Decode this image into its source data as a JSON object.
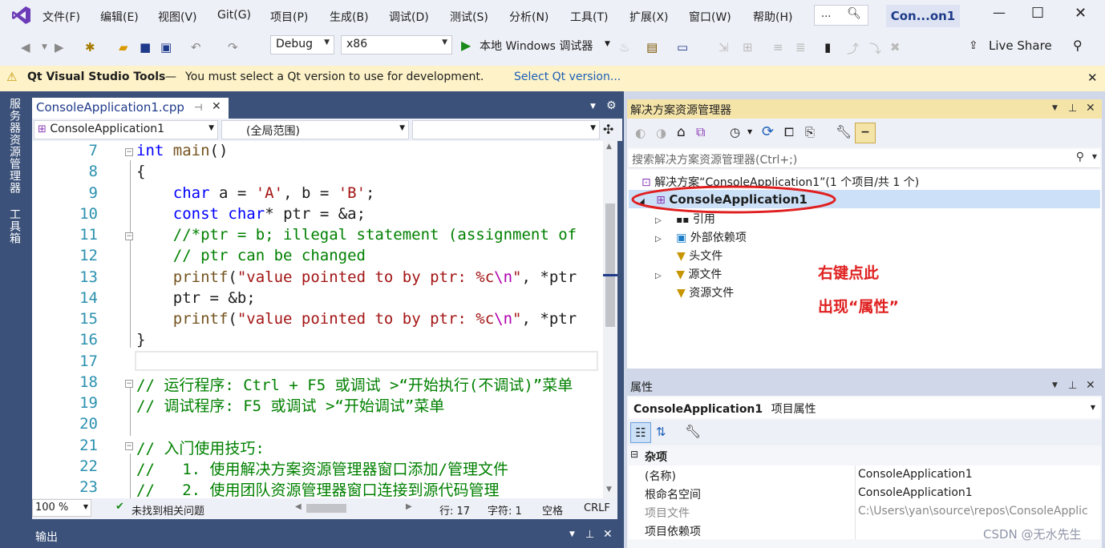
{
  "menu": {
    "items": [
      "文件(F)",
      "编辑(E)",
      "视图(V)",
      "Git(G)",
      "项目(P)",
      "生成(B)",
      "调试(D)",
      "测试(S)",
      "分析(N)",
      "工具(T)",
      "扩展(X)",
      "窗口(W)",
      "帮助(H)"
    ],
    "search_placeholder": "...",
    "title": "Con...on1"
  },
  "toolbar": {
    "config": "Debug",
    "platform": "x86",
    "run_label": "本地 Windows 调试器",
    "live_share": "Live Share"
  },
  "infobar": {
    "title": "Qt Visual Studio Tools",
    "dash": "—",
    "message": "You must select a Qt version to use for development.",
    "link": "Select Qt version..."
  },
  "side_tabs": [
    "服务器资源管理器",
    "工具箱"
  ],
  "editor": {
    "tab": "ConsoleApplication1.cpp",
    "nav_project": "ConsoleApplication1",
    "nav_scope": "(全局范围)",
    "nav_member": "",
    "line_numbers": [
      "7",
      "8",
      "9",
      "10",
      "11",
      "12",
      "13",
      "14",
      "15",
      "16",
      "17",
      "18",
      "19",
      "20",
      "21",
      "22",
      "23"
    ]
  },
  "status": {
    "zoom": "100 %",
    "issues": "未找到相关问题",
    "line": "行: 17",
    "char": "字符: 1",
    "spaces": "空格",
    "eol": "CRLF"
  },
  "output": {
    "title": "输出"
  },
  "solution_explorer": {
    "title": "解决方案资源管理器",
    "search_placeholder": "搜索解决方案资源管理器(Ctrl+;)",
    "solution": "解决方案“ConsoleApplication1”(1 个项目/共 1 个)",
    "project": "ConsoleApplication1",
    "nodes": [
      "引用",
      "外部依赖项",
      "头文件",
      "源文件",
      "资源文件"
    ],
    "annotation_1": "右键点此",
    "annotation_2": "出现“属性”"
  },
  "properties": {
    "title": "属性",
    "selected_object": "ConsoleApplication1",
    "selected_type": "项目属性",
    "category": "杂项",
    "rows": [
      {
        "key": "(名称)",
        "value": "ConsoleApplication1"
      },
      {
        "key": "根命名空间",
        "value": "ConsoleApplication1"
      },
      {
        "key": "项目文件",
        "value": "C:\\Users\\yan\\source\\repos\\ConsoleApplic"
      },
      {
        "key": "项目依赖项",
        "value": ""
      }
    ]
  },
  "watermark": "CSDN @无水先生",
  "colors": {
    "accent": "#1e3a8a",
    "infobar": "#fdf2c8",
    "annotation": "#e02020",
    "selection": "#cce0f7"
  }
}
